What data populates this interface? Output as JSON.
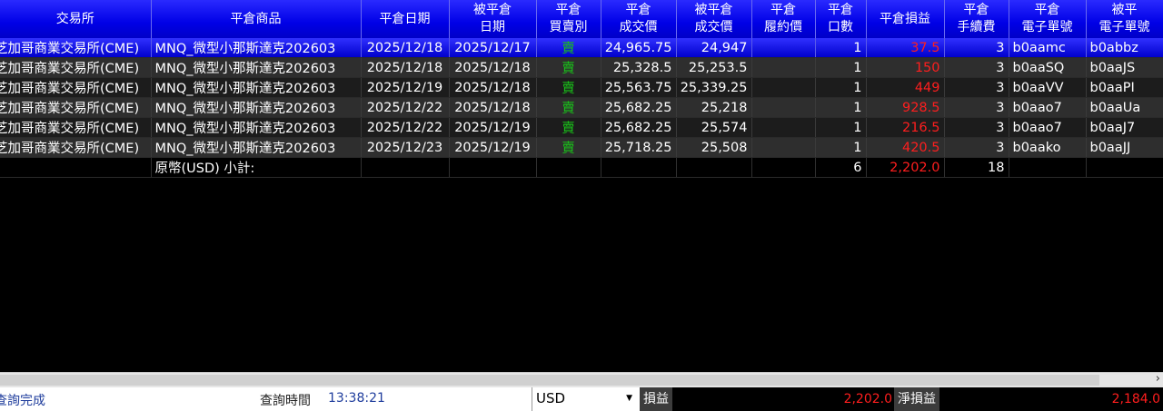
{
  "columns": [
    {
      "key": "exchange",
      "label": "交易所"
    },
    {
      "key": "product",
      "label": "平倉商品"
    },
    {
      "key": "close_date",
      "label": "平倉日期"
    },
    {
      "key": "closed_date",
      "label": "被平倉\n日期"
    },
    {
      "key": "side",
      "label": "平倉\n買賣別"
    },
    {
      "key": "close_price",
      "label": "平倉\n成交價"
    },
    {
      "key": "closed_price",
      "label": "被平倉\n成交價"
    },
    {
      "key": "strike",
      "label": "平倉\n履約價"
    },
    {
      "key": "qty",
      "label": "平倉\n口數"
    },
    {
      "key": "pnl",
      "label": "平倉損益"
    },
    {
      "key": "fee",
      "label": "平倉\n手續費"
    },
    {
      "key": "order_no",
      "label": "平倉\n電子單號"
    },
    {
      "key": "closed_order_no",
      "label": "被平\n電子單號"
    }
  ],
  "rows": [
    {
      "exchange": "芝加哥商業交易所(CME)",
      "product": "MNQ_微型小那斯達克202603",
      "close_date": "2025/12/18",
      "closed_date": "2025/12/17",
      "side": "賣",
      "close_price": "24,965.75",
      "closed_price": "24,947",
      "strike": "",
      "qty": "1",
      "pnl": "37.5",
      "fee": "3",
      "order_no": "b0aamc",
      "closed_order_no": "b0abbz"
    },
    {
      "exchange": "芝加哥商業交易所(CME)",
      "product": "MNQ_微型小那斯達克202603",
      "close_date": "2025/12/18",
      "closed_date": "2025/12/18",
      "side": "賣",
      "close_price": "25,328.5",
      "closed_price": "25,253.5",
      "strike": "",
      "qty": "1",
      "pnl": "150",
      "fee": "3",
      "order_no": "b0aaSQ",
      "closed_order_no": "b0aaJS"
    },
    {
      "exchange": "芝加哥商業交易所(CME)",
      "product": "MNQ_微型小那斯達克202603",
      "close_date": "2025/12/19",
      "closed_date": "2025/12/18",
      "side": "賣",
      "close_price": "25,563.75",
      "closed_price": "25,339.25",
      "strike": "",
      "qty": "1",
      "pnl": "449",
      "fee": "3",
      "order_no": "b0aaVV",
      "closed_order_no": "b0aaPI"
    },
    {
      "exchange": "芝加哥商業交易所(CME)",
      "product": "MNQ_微型小那斯達克202603",
      "close_date": "2025/12/22",
      "closed_date": "2025/12/18",
      "side": "賣",
      "close_price": "25,682.25",
      "closed_price": "25,218",
      "strike": "",
      "qty": "1",
      "pnl": "928.5",
      "fee": "3",
      "order_no": "b0aao7",
      "closed_order_no": "b0aaUa"
    },
    {
      "exchange": "芝加哥商業交易所(CME)",
      "product": "MNQ_微型小那斯達克202603",
      "close_date": "2025/12/22",
      "closed_date": "2025/12/19",
      "side": "賣",
      "close_price": "25,682.25",
      "closed_price": "25,574",
      "strike": "",
      "qty": "1",
      "pnl": "216.5",
      "fee": "3",
      "order_no": "b0aao7",
      "closed_order_no": "b0aaJ7"
    },
    {
      "exchange": "芝加哥商業交易所(CME)",
      "product": "MNQ_微型小那斯達克202603",
      "close_date": "2025/12/23",
      "closed_date": "2025/12/19",
      "side": "賣",
      "close_price": "25,718.25",
      "closed_price": "25,508",
      "strike": "",
      "qty": "1",
      "pnl": "420.5",
      "fee": "3",
      "order_no": "b0aako",
      "closed_order_no": "b0aaJJ"
    }
  ],
  "subtotal": {
    "label": "原幣(USD) 小計:",
    "qty": "6",
    "pnl": "2,202.0",
    "fee": "18"
  },
  "status": {
    "message": "查詢完成",
    "query_time_label": "查詢時間",
    "query_time": "13:38:21",
    "currency": "USD",
    "pnl_label": "損益",
    "pnl_value": "2,202.0",
    "net_pnl_label": "淨損益",
    "net_pnl_value": "2,184.0"
  },
  "colors": {
    "header": "#0000e6",
    "selected_row": "#0000cc",
    "sell": "#19c219",
    "pnl": "#ff1e1e"
  },
  "icons": {
    "scroll_right": "›",
    "dropdown": "▼"
  }
}
